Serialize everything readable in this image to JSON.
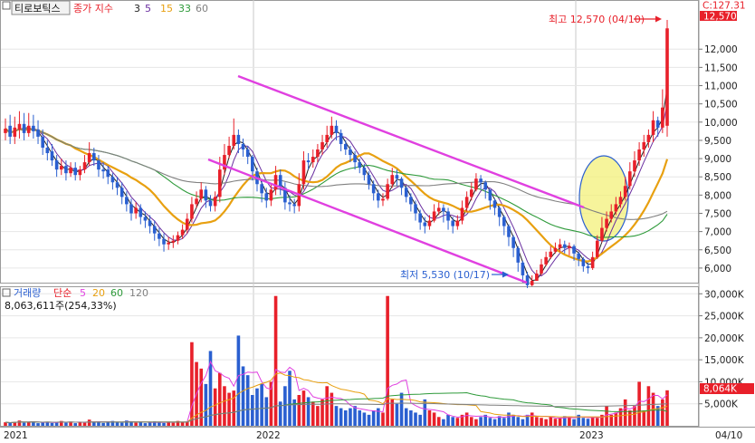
{
  "chart_data": {
    "type": "candlestick",
    "header": {
      "stock_name": "티로보틱스",
      "indicator_label": "종가 지수",
      "ma_periods": [
        "3",
        "5",
        "15",
        "33",
        "60"
      ],
      "current_label": "C:127.31"
    },
    "price_axis": {
      "min": 5600,
      "max": 12900,
      "ticks": [
        "12,000",
        "11,500",
        "11,000",
        "10,500",
        "10,000",
        "9,500",
        "9,000",
        "8,500",
        "8,000",
        "7,500",
        "7,000",
        "6,500",
        "6,000"
      ],
      "tick_values": [
        12000,
        11500,
        11000,
        10500,
        10000,
        9500,
        9000,
        8500,
        8000,
        7500,
        7000,
        6500,
        6000
      ],
      "last_price_label": "12,570",
      "last_price": 12570
    },
    "annotations": {
      "high": {
        "label": "최고 12,570 (04/10)",
        "value": 12570
      },
      "low": {
        "label": "최저 5,530 (10/17)",
        "value": 5530
      }
    },
    "volume": {
      "title": "거래량",
      "ma_label": "단순",
      "ma_periods": [
        "5",
        "20",
        "60",
        "120"
      ],
      "last_value_label": "8,063,611주(254,33%)",
      "last_tag": "8,064K",
      "last_value": 8064,
      "unit": "K",
      "max": 31500,
      "ticks": [
        "30,000K",
        "25,000K",
        "20,000K",
        "15,000K",
        "10,000K",
        "5,000K"
      ],
      "tick_values": [
        30000,
        25000,
        20000,
        15000,
        10000,
        5000
      ]
    },
    "x_axis": {
      "labels": [
        "2021",
        "2022",
        "2023",
        "04/10"
      ]
    },
    "colors": {
      "up": "#e8202a",
      "down": "#2a5fd0",
      "channel": "#e040e0",
      "ma3": "#222222",
      "ma5": "#6a2fa0",
      "ma15": "#e8a010",
      "ma33": "#2e9a3a",
      "ma60": "#808080",
      "highlight": "#f3f07a"
    },
    "price_series": {
      "close": [
        9820,
        9600,
        9850,
        9950,
        9700,
        9900,
        9750,
        9600,
        9300,
        9150,
        8950,
        8700,
        8800,
        8600,
        8750,
        8550,
        8700,
        8900,
        9150,
        8950,
        8700,
        8650,
        8500,
        8350,
        8200,
        7950,
        7750,
        7500,
        7650,
        7400,
        7300,
        7150,
        6950,
        6800,
        6650,
        6700,
        6750,
        6900,
        7050,
        7350,
        7750,
        7900,
        8150,
        7850,
        7700,
        7950,
        8700,
        9100,
        9350,
        9650,
        9400,
        9250,
        9050,
        8650,
        8300,
        8050,
        7850,
        8150,
        8550,
        8200,
        7800,
        7750,
        7700,
        8300,
        8950,
        8900,
        9050,
        9250,
        9450,
        9650,
        9900,
        9700,
        9400,
        9250,
        9100,
        8900,
        8750,
        8550,
        8300,
        8050,
        7850,
        7900,
        8300,
        8550,
        8450,
        8200,
        7950,
        7750,
        7500,
        7250,
        7150,
        7300,
        7550,
        7650,
        7550,
        7300,
        7150,
        7300,
        7650,
        7950,
        8150,
        8450,
        8350,
        8150,
        7850,
        7650,
        7400,
        7150,
        6850,
        6550,
        6150,
        5800,
        5530,
        5650,
        5850,
        6100,
        6300,
        6450,
        6550,
        6650,
        6550,
        6600,
        6400,
        6250,
        6050,
        6000,
        6300,
        6750,
        7100,
        7350,
        7550,
        7750,
        7950,
        8250,
        8650,
        8950,
        9250,
        9450,
        9650,
        10050,
        9850,
        10400,
        12570
      ],
      "open": [
        9700,
        9900,
        9600,
        9800,
        9950,
        9700,
        9900,
        9800,
        9600,
        9300,
        9200,
        8950,
        8700,
        8800,
        8600,
        8750,
        8550,
        8700,
        8900,
        9150,
        8950,
        8700,
        8700,
        8500,
        8350,
        8200,
        7950,
        7750,
        7500,
        7650,
        7400,
        7300,
        7150,
        6950,
        6800,
        6650,
        6700,
        6750,
        6900,
        7050,
        7350,
        7750,
        7900,
        8150,
        7850,
        7700,
        7950,
        8700,
        9100,
        9350,
        9650,
        9400,
        9250,
        9050,
        8650,
        8300,
        8050,
        7850,
        8150,
        8550,
        8200,
        7800,
        7750,
        7700,
        8300,
        8950,
        8900,
        9050,
        9250,
        9450,
        9650,
        9900,
        9700,
        9400,
        9250,
        9100,
        8900,
        8750,
        8550,
        8300,
        8050,
        7850,
        7900,
        8300,
        8550,
        8450,
        8200,
        7950,
        7750,
        7500,
        7250,
        7150,
        7300,
        7550,
        7650,
        7550,
        7300,
        7150,
        7300,
        7650,
        7950,
        8150,
        8450,
        8350,
        8150,
        7850,
        7650,
        7400,
        7150,
        6850,
        6550,
        6150,
        5800,
        5530,
        5650,
        5850,
        6100,
        6300,
        6450,
        6550,
        6650,
        6550,
        6600,
        6400,
        6250,
        6050,
        6000,
        6300,
        6750,
        7100,
        7350,
        7550,
        7750,
        7950,
        8250,
        8650,
        8950,
        9250,
        9450,
        9650,
        10050,
        9850,
        9900
      ],
      "high": [
        10100,
        10200,
        10150,
        10300,
        10250,
        10250,
        10200,
        10050,
        9800,
        9500,
        9400,
        9100,
        9000,
        8950,
        8900,
        8900,
        8800,
        9100,
        9450,
        9300,
        9100,
        8900,
        8800,
        8600,
        8500,
        8350,
        8100,
        7900,
        7800,
        7750,
        7550,
        7450,
        7300,
        7100,
        6950,
        6850,
        6900,
        7000,
        7200,
        7500,
        7950,
        8100,
        8350,
        8250,
        8000,
        8100,
        9050,
        9400,
        9600,
        10100,
        9800,
        9550,
        9350,
        9100,
        8750,
        8450,
        8200,
        8300,
        8800,
        8700,
        8350,
        8000,
        7900,
        8600,
        9200,
        9150,
        9250,
        9400,
        9650,
        9900,
        10150,
        10050,
        9800,
        9500,
        9350,
        9200,
        9000,
        8850,
        8650,
        8400,
        8150,
        8050,
        8450,
        8750,
        8700,
        8500,
        8250,
        8050,
        7850,
        7600,
        7400,
        7450,
        7750,
        7800,
        7750,
        7650,
        7400,
        7450,
        7850,
        8100,
        8350,
        8600,
        8550,
        8400,
        8100,
        7900,
        7700,
        7450,
        7200,
        6900,
        6600,
        6200,
        5900,
        5800,
        5950,
        6250,
        6450,
        6600,
        6700,
        6800,
        6750,
        6700,
        6650,
        6450,
        6300,
        6150,
        6450,
        6900,
        7400,
        7550,
        7750,
        7950,
        8100,
        8500,
        8900,
        9200,
        9450,
        9650,
        9800,
        10300,
        10150,
        10900,
        12800
      ],
      "low": [
        9500,
        9400,
        9400,
        9550,
        9500,
        9600,
        9550,
        9400,
        9100,
        8950,
        8800,
        8500,
        8550,
        8400,
        8500,
        8400,
        8400,
        8600,
        8800,
        8800,
        8500,
        8450,
        8300,
        8150,
        8000,
        7750,
        7550,
        7300,
        7350,
        7200,
        7100,
        6950,
        6750,
        6600,
        6450,
        6500,
        6550,
        6650,
        6800,
        6950,
        7250,
        7650,
        7800,
        7650,
        7550,
        7550,
        7800,
        8550,
        9000,
        9250,
        9150,
        9050,
        8850,
        8400,
        8100,
        7800,
        7650,
        7700,
        8000,
        8000,
        7600,
        7550,
        7500,
        7550,
        8150,
        8700,
        8750,
        8900,
        9100,
        9300,
        9550,
        9500,
        9200,
        9100,
        8900,
        8700,
        8600,
        8400,
        8150,
        7850,
        7650,
        7700,
        7850,
        8200,
        8250,
        8000,
        7800,
        7550,
        7300,
        7050,
        6950,
        7050,
        7250,
        7450,
        7250,
        7050,
        6950,
        7050,
        7200,
        7550,
        7850,
        8100,
        8150,
        7900,
        7600,
        7450,
        7150,
        6900,
        6600,
        6300,
        5900,
        5600,
        5450,
        5500,
        5650,
        5800,
        6050,
        6250,
        6400,
        6450,
        6400,
        6350,
        6200,
        6050,
        5900,
        5850,
        5950,
        6250,
        6700,
        7000,
        7250,
        7450,
        7650,
        7850,
        8150,
        8500,
        8800,
        9050,
        9300,
        9450,
        9600,
        9700,
        9600
      ]
    },
    "volume_series": [
      800,
      650,
      900,
      1200,
      700,
      850,
      1000,
      600,
      750,
      900,
      650,
      800,
      1100,
      700,
      950,
      600,
      850,
      700,
      1400,
      900,
      750,
      650,
      800,
      1100,
      900,
      700,
      1200,
      850,
      700,
      900,
      600,
      750,
      1000,
      800,
      650,
      900,
      700,
      1100,
      800,
      950,
      19000,
      14500,
      13000,
      9500,
      17000,
      8500,
      12000,
      9000,
      7500,
      8000,
      20500,
      13500,
      11500,
      7000,
      8500,
      9500,
      6500,
      10000,
      29500,
      5500,
      9000,
      12500,
      6000,
      7000,
      8000,
      6500,
      5500,
      4500,
      6000,
      9000,
      7500,
      4500,
      4000,
      3500,
      4000,
      4500,
      3500,
      3000,
      2500,
      3500,
      4000,
      3000,
      29500,
      6000,
      5000,
      7500,
      4000,
      3500,
      3000,
      2500,
      6000,
      3500,
      3000,
      2000,
      1500,
      2500,
      2000,
      1800,
      2500,
      3000,
      2000,
      1500,
      2000,
      2500,
      1800,
      1500,
      2200,
      1800,
      3000,
      2500,
      2000,
      1500,
      2500,
      3000,
      2000,
      1800,
      1500,
      2000,
      1600,
      1800,
      2200,
      2000,
      1500,
      2500,
      1800,
      1600,
      2000,
      1800,
      2500,
      4500,
      2500,
      3000,
      4000,
      6000,
      3500,
      4500,
      10000,
      3500,
      9000,
      7500,
      4500,
      6000,
      8064
    ]
  }
}
